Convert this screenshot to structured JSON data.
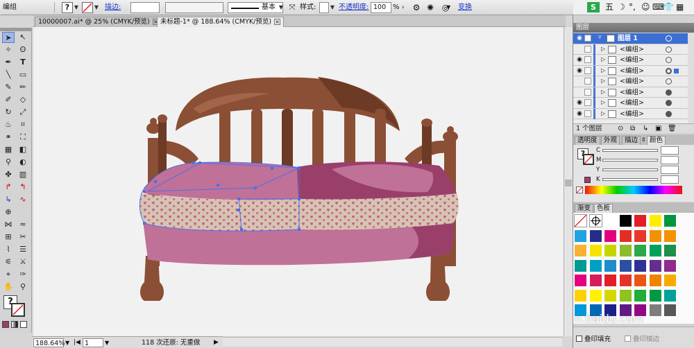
{
  "control_bar": {
    "selection_label": "编组",
    "stroke_link": "描边:",
    "stroke_profile": "基本",
    "style_label": "样式:",
    "opacity_link": "不透明度:",
    "opacity_value": "100",
    "opacity_unit": "%",
    "transform_link": "变换"
  },
  "document_tabs": [
    {
      "label": "10000007.ai* @ 25% (CMYK/预览)"
    },
    {
      "label": "未标题-1* @ 188.64% (CMYK/预览)"
    }
  ],
  "status_bar": {
    "zoom": "188.64%",
    "artboard": "1",
    "undo_info": "118 次还原: 无重做"
  },
  "layers_panel": {
    "title": "图层",
    "layer_name": "图层 1",
    "items": [
      {
        "label": "<编组>",
        "eye": true
      },
      {
        "label": "<编组>",
        "eye": false
      },
      {
        "label": "<编组>",
        "eye": true
      },
      {
        "label": "<编组>",
        "eye": false
      },
      {
        "label": "<编组>",
        "eye": false
      },
      {
        "label": "<编组>",
        "eye": true
      },
      {
        "label": "<编组>",
        "eye": true
      }
    ],
    "footer_count": "1 个图层"
  },
  "color_panel": {
    "tabs": [
      "透明度",
      "外观",
      "描边",
      "颜色"
    ],
    "channels": [
      "C",
      "M",
      "Y",
      "K"
    ],
    "fill_color": "#9a3f6a"
  },
  "swatches_panel": {
    "tabs": [
      "渐变",
      "色板"
    ],
    "rows": [
      [
        "none",
        "reg",
        "#ffffff",
        "#000000",
        "#e21e26",
        "#ffed00",
        "#009640"
      ],
      [
        "#1fa3e0",
        "#262d88",
        "#e4007f",
        "#e42d24",
        "#e8372b",
        "#f39200",
        "#f39200"
      ],
      [
        "#f9b233",
        "#f7e300",
        "#c6d400",
        "#8dbb2e",
        "#2aa84b",
        "#00a15a",
        "#1e8f4c"
      ],
      [
        "#009a93",
        "#00a0c6",
        "#1f8ccc",
        "#2b4fa1",
        "#2e3192",
        "#662d91",
        "#8e2b8c"
      ],
      [
        "#e4007f",
        "#d61c5b",
        "#e21e26",
        "#e6332a",
        "#ea5514",
        "#f08300",
        "#f6ab00"
      ],
      [
        "#fdd000",
        "#fff100",
        "#d5d800",
        "#8fc31f",
        "#22ac38",
        "#009944",
        "#00a29a"
      ],
      [
        "#0098d8",
        "#0068b7",
        "#1d2088",
        "#601986",
        "#920783",
        "#7d7d7d",
        "#595757"
      ]
    ],
    "bottom_options": [
      "叠印填充",
      "叠印描边"
    ]
  },
  "taskbar": {
    "ime_label": "五"
  },
  "watermark": "n.baidu.com",
  "colors": {
    "wood": "#8b4f35",
    "wood_dark": "#6d3a25",
    "cushion": "#c07198",
    "cushion_dark": "#9a3f6a",
    "pattern_bg": "#d6c3b3",
    "heart": "#c2607f",
    "selection": "#4c6fe6"
  }
}
